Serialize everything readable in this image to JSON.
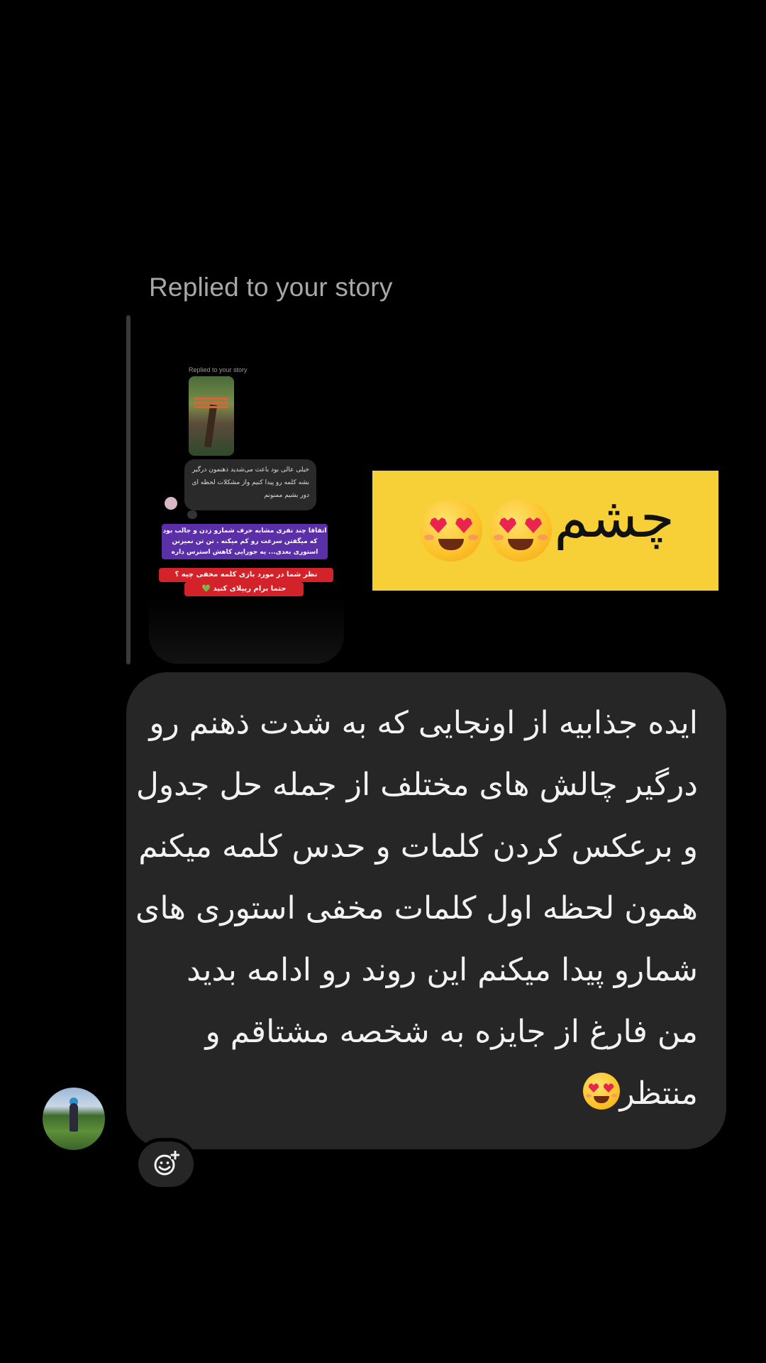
{
  "reply_header": "Replied to your story",
  "story_preview": {
    "header": "Replied to your story",
    "bubble_text": "خیلی عالی بود باعث می‌شدید ذهنمون درگیر بشه کلمه رو پیدا کنیم واز مشکلات لحظه ای دور بشیم ممنونم",
    "purple_text": "اتفاقا چند نفری مشابه حرف شمارو زدن و جالب بود که میگفتن سرعت رو کم میکنه . تن تن نمیزنن استوری بعدی... یه جورایی کاهش استرس داره",
    "red_line1": "نظر شما در مورد بازی کلمه مخفی چیه ؟",
    "red_line2": "حتما برام ریپلای کنید 💚"
  },
  "sticker": {
    "word": "چشم",
    "emoji": "heart-eyes",
    "background": "#f7d038"
  },
  "message": {
    "lines": [
      "ایده جذابیه از اونجایی که به شدت ذهنم رو",
      "درگیر چالش های مختلف از جمله حل جدول",
      "و برعکس کردن کلمات و حدس کلمه میکنم",
      "همون لحظه اول کلمات مخفی استوری های",
      "شمارو پیدا میکنم این روند رو ادامه بدید",
      "من فارغ از جایزه به شخصه مشتاقم و",
      "منتظر"
    ],
    "trailing_emoji": "heart-eyes"
  },
  "react_button": {
    "icon": "add-reaction-icon"
  },
  "colors": {
    "background": "#000000",
    "bubble": "#262626",
    "muted_text": "#a8a8a8"
  }
}
